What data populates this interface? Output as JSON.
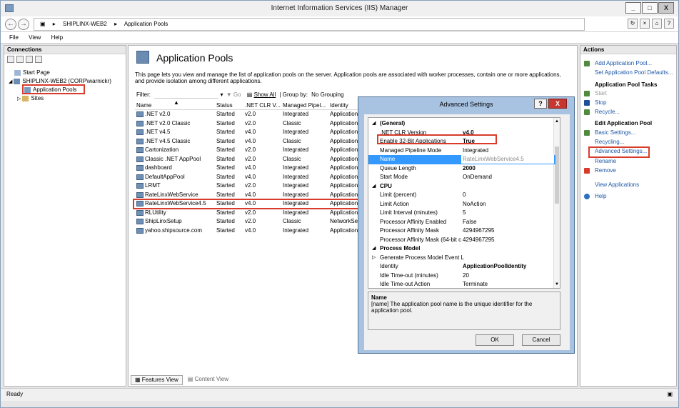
{
  "window": {
    "title": "Internet Information Services (IIS) Manager",
    "controls": [
      "_",
      "□",
      "X"
    ]
  },
  "address": {
    "segments": [
      "SHIPLINX-WEB2",
      "Application Pools"
    ]
  },
  "menu": [
    "File",
    "View",
    "Help"
  ],
  "connections": {
    "title": "Connections",
    "tree": [
      "Start Page",
      "SHIPLINX-WEB2 (CORP\\warnickr)",
      "Application Pools",
      "Sites"
    ]
  },
  "main": {
    "heading": "Application Pools",
    "description": "This page lets you view and manage the list of application pools on the server. Application pools are associated with worker processes, contain one or more applications, and provide isolation among different applications.",
    "filter_label": "Filter:",
    "go_label": "Go",
    "show_all_label": "Show All",
    "group_by_label": "Group by:",
    "group_by_value": "No Grouping",
    "columns": [
      "Name",
      "Status",
      ".NET CLR V...",
      "Managed Pipel...",
      "Identity"
    ],
    "rows": [
      [
        ".NET v2.0",
        "Started",
        "v2.0",
        "Integrated",
        "Application"
      ],
      [
        ".NET v2.0 Classic",
        "Started",
        "v2.0",
        "Classic",
        "Application"
      ],
      [
        ".NET v4.5",
        "Started",
        "v4.0",
        "Integrated",
        "Application"
      ],
      [
        ".NET v4.5 Classic",
        "Started",
        "v4.0",
        "Classic",
        "Application"
      ],
      [
        "Cartonization",
        "Started",
        "v2.0",
        "Integrated",
        "Application"
      ],
      [
        "Classic .NET AppPool",
        "Started",
        "v2.0",
        "Classic",
        "Application"
      ],
      [
        "dashboard",
        "Started",
        "v4.0",
        "Integrated",
        "Application"
      ],
      [
        "DefaultAppPool",
        "Started",
        "v4.0",
        "Integrated",
        "Application"
      ],
      [
        "LRMT",
        "Started",
        "v2.0",
        "Integrated",
        "Application"
      ],
      [
        "RateLinxWebService",
        "Started",
        "v4.0",
        "Integrated",
        "Application"
      ],
      [
        "RateLinxWebService4.5",
        "Started",
        "v4.0",
        "Integrated",
        "Application"
      ],
      [
        "RLUtility",
        "Started",
        "v2.0",
        "Integrated",
        "Application"
      ],
      [
        "ShipLinxSetup",
        "Started",
        "v2.0",
        "Classic",
        "NetworkSe"
      ],
      [
        "yahoo.shipsource.com",
        "Started",
        "v4.0",
        "Integrated",
        "Application"
      ]
    ],
    "tabs": [
      "Features View",
      "Content View"
    ]
  },
  "actions": {
    "title": "Actions",
    "items": [
      {
        "label": "Add Application Pool...",
        "kind": "link"
      },
      {
        "label": "Set Application Pool Defaults...",
        "kind": "link"
      },
      {
        "label": "Application Pool Tasks",
        "kind": "head"
      },
      {
        "label": "Start",
        "kind": "disabled"
      },
      {
        "label": "Stop",
        "kind": "link"
      },
      {
        "label": "Recycle...",
        "kind": "link"
      },
      {
        "label": "Edit Application Pool",
        "kind": "head"
      },
      {
        "label": "Basic Settings...",
        "kind": "link"
      },
      {
        "label": "Recycling...",
        "kind": "link"
      },
      {
        "label": "Advanced Settings...",
        "kind": "link"
      },
      {
        "label": "Rename",
        "kind": "link"
      },
      {
        "label": "Remove",
        "kind": "link"
      },
      {
        "label": "View Applications",
        "kind": "link"
      },
      {
        "label": "Help",
        "kind": "link"
      }
    ]
  },
  "status": {
    "text": "Ready"
  },
  "dialog": {
    "title": "Advanced Settings",
    "help": "?",
    "close": "X",
    "rows": [
      {
        "type": "cat",
        "key": "(General)"
      },
      {
        "type": "prop",
        "key": ".NET CLR Version",
        "value": "v4.0"
      },
      {
        "type": "prop",
        "key": "Enable 32-Bit Applications",
        "value": "True"
      },
      {
        "type": "prop",
        "key": "Managed Pipeline Mode",
        "value": "Integrated"
      },
      {
        "type": "prop",
        "key": "Name",
        "value": "RateLinxWebService4.5"
      },
      {
        "type": "prop",
        "key": "Queue Length",
        "value": "2000"
      },
      {
        "type": "prop",
        "key": "Start Mode",
        "value": "OnDemand"
      },
      {
        "type": "cat",
        "key": "CPU"
      },
      {
        "type": "prop",
        "key": "Limit (percent)",
        "value": "0"
      },
      {
        "type": "prop",
        "key": "Limit Action",
        "value": "NoAction"
      },
      {
        "type": "prop",
        "key": "Limit Interval (minutes)",
        "value": "5"
      },
      {
        "type": "prop",
        "key": "Processor Affinity Enabled",
        "value": "False"
      },
      {
        "type": "prop",
        "key": "Processor Affinity Mask",
        "value": "4294967295"
      },
      {
        "type": "prop",
        "key": "Processor Affinity Mask (64-bit c",
        "value": "4294967295"
      },
      {
        "type": "cat",
        "key": "Process Model"
      },
      {
        "type": "prop",
        "key": "Generate Process Model Event L",
        "value": ""
      },
      {
        "type": "prop",
        "key": "Identity",
        "value": "ApplicationPoolIdentity"
      },
      {
        "type": "prop",
        "key": "Idle Time-out (minutes)",
        "value": "20"
      },
      {
        "type": "prop",
        "key": "Idle Time-out Action",
        "value": "Terminate"
      }
    ],
    "desc_title": "Name",
    "desc_text": "[name] The application pool name is the unique identifier for the application pool.",
    "ok": "OK",
    "cancel": "Cancel"
  }
}
